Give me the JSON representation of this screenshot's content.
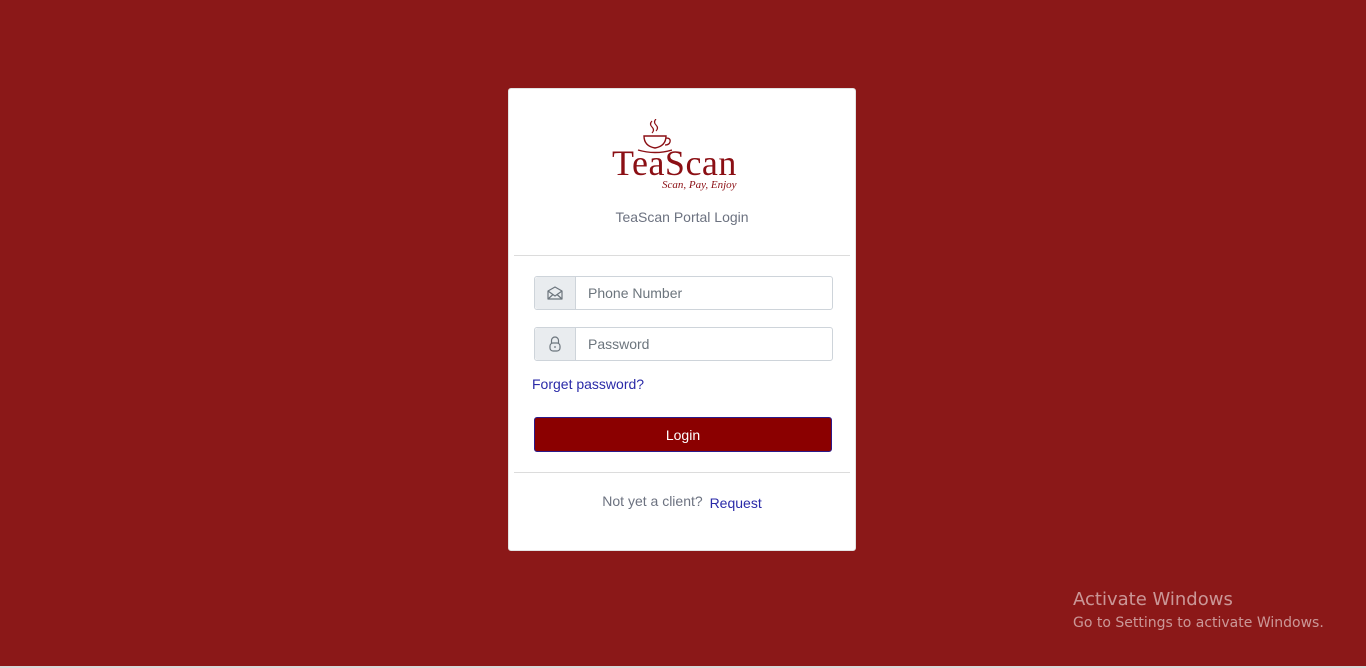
{
  "brand": {
    "name": "TeaScan",
    "tagline": "Scan, Pay, Enjoy",
    "color": "#8b0f14"
  },
  "login": {
    "title": "TeaScan Portal Login",
    "phone_placeholder": "Phone Number",
    "phone_icon": "envelope-icon",
    "password_placeholder": "Password",
    "password_icon": "lock-icon",
    "forget_password": "Forget password?",
    "login_button": "Login",
    "not_client": "Not yet a client?",
    "request_link": "Request"
  },
  "colors": {
    "background": "#8b1818",
    "button": "#8b0000",
    "link": "#2a2aa8"
  },
  "windows_watermark": {
    "title": "Activate Windows",
    "subtitle": "Go to Settings to activate Windows."
  }
}
